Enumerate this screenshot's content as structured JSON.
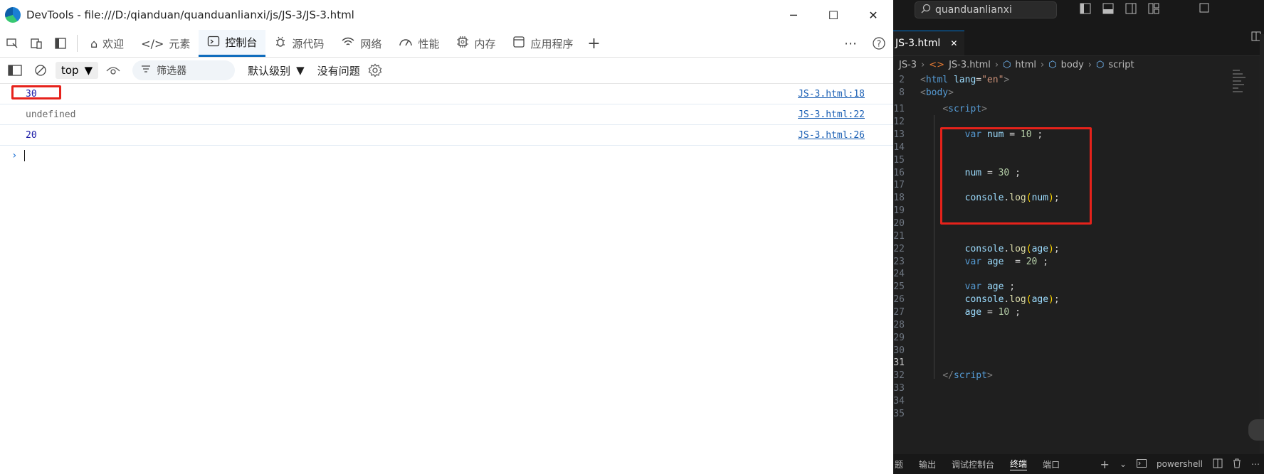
{
  "devtools": {
    "window_title": "DevTools - file:///D:/qianduan/quanduanlianxi/js/JS-3/JS-3.html",
    "window_buttons": {
      "minimize": "─",
      "maximize": "☐",
      "close": "✕"
    },
    "tabs": [
      {
        "label": "欢迎",
        "icon": "home-icon"
      },
      {
        "label": "元素",
        "icon": "code-icon"
      },
      {
        "label": "控制台",
        "icon": "console-icon",
        "active": true
      },
      {
        "label": "源代码",
        "icon": "bug-icon"
      },
      {
        "label": "网络",
        "icon": "wifi-icon"
      },
      {
        "label": "性能",
        "icon": "gauge-icon"
      },
      {
        "label": "内存",
        "icon": "chip-icon"
      },
      {
        "label": "应用程序",
        "icon": "app-icon"
      }
    ],
    "toolbar": {
      "context": "top",
      "filter_placeholder": "筛选器",
      "level": "默认级别",
      "issues": "没有问题"
    },
    "messages": [
      {
        "value": "30",
        "source": "JS-3.html:18",
        "type": "number"
      },
      {
        "value": "undefined",
        "source": "JS-3.html:22",
        "type": "undefined"
      },
      {
        "value": "20",
        "source": "JS-3.html:26",
        "type": "number"
      }
    ]
  },
  "vscode": {
    "search": "quanduanlianxi",
    "tab": {
      "label": "JS-3.html",
      "close": "✕"
    },
    "breadcrumbs": [
      "JS-3",
      "JS-3.html",
      "html",
      "body",
      "script"
    ],
    "lines": [
      {
        "n": "2",
        "html": "<span class='tb'>&lt;</span><span class='tg'>html</span> <span class='at'>lang</span><span class='pl'>=</span><span class='st'>\"en\"</span><span class='tb'>&gt;</span>"
      },
      {
        "n": "8",
        "html": "<span class='tb'>&lt;</span><span class='tg'>body</span><span class='tb'>&gt;</span>"
      },
      {
        "n": "11",
        "html": "    <span class='tb'>&lt;</span><span class='tg'>script</span><span class='tb'>&gt;</span>"
      },
      {
        "n": "12",
        "html": ""
      },
      {
        "n": "13",
        "html": "        <span class='kw'>var</span> <span class='vr'>num</span> <span class='pl'>=</span> <span class='nm'>10</span> <span class='pl'>;</span>"
      },
      {
        "n": "14",
        "html": ""
      },
      {
        "n": "15",
        "html": ""
      },
      {
        "n": "16",
        "html": "        <span class='vr'>num</span> <span class='pl'>=</span> <span class='nm'>30</span> <span class='pl'>;</span>"
      },
      {
        "n": "17",
        "html": ""
      },
      {
        "n": "18",
        "html": "        <span class='vr'>console</span><span class='pl'>.</span><span class='fn'>log</span><span class='br'>(</span><span class='vr'>num</span><span class='br'>)</span><span class='pl'>;</span>"
      },
      {
        "n": "19",
        "html": ""
      },
      {
        "n": "20",
        "html": ""
      },
      {
        "n": "21",
        "html": ""
      },
      {
        "n": "22",
        "html": "        <span class='vr'>console</span><span class='pl'>.</span><span class='fn'>log</span><span class='br'>(</span><span class='vr'>age</span><span class='br'>)</span><span class='pl'>;</span>"
      },
      {
        "n": "23",
        "html": "        <span class='kw'>var</span> <span class='vr'>age</span>  <span class='pl'>=</span> <span class='nm'>20</span> <span class='pl'>;</span>"
      },
      {
        "n": "24",
        "html": ""
      },
      {
        "n": "25",
        "html": "        <span class='kw'>var</span> <span class='vr'>age</span> <span class='pl'>;</span>"
      },
      {
        "n": "26",
        "html": "        <span class='vr'>console</span><span class='pl'>.</span><span class='fn'>log</span><span class='br'>(</span><span class='vr'>age</span><span class='br'>)</span><span class='pl'>;</span>"
      },
      {
        "n": "27",
        "html": "        <span class='vr'>age</span> <span class='pl'>=</span> <span class='nm'>10</span> <span class='pl'>;</span>"
      },
      {
        "n": "28",
        "html": ""
      },
      {
        "n": "29",
        "html": ""
      },
      {
        "n": "30",
        "html": ""
      },
      {
        "n": "31",
        "html": "",
        "current": true
      },
      {
        "n": "32",
        "html": "    <span class='tb'>&lt;/</span><span class='tg'>script</span><span class='tb'>&gt;</span>"
      },
      {
        "n": "33",
        "html": ""
      },
      {
        "n": "34",
        "html": ""
      },
      {
        "n": "35",
        "html": ""
      }
    ],
    "panel_tabs": [
      {
        "label": "题"
      },
      {
        "label": "输出"
      },
      {
        "label": "调试控制台"
      },
      {
        "label": "终端",
        "active": true
      },
      {
        "label": "端口"
      }
    ],
    "terminal": "powershell"
  }
}
